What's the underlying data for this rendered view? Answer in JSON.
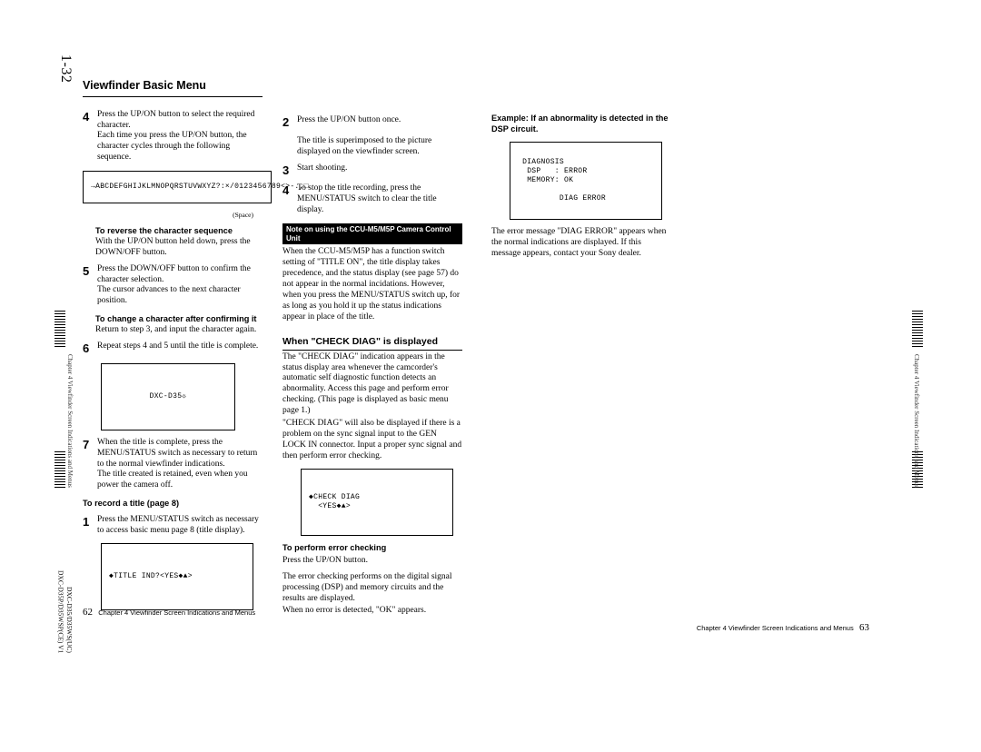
{
  "sheetNumber": "1-32",
  "sideCaption": "Chapter 4  Viewfinder Screen Indications and Menus",
  "modelLine1": "DXC-D35/D35WS(UC)",
  "modelLine2": "DXC-D35P/D35WSP(CE) V1",
  "p62": {
    "title": "Viewfinder Basic Menu",
    "col1": {
      "step4a": "Press the UP/ON button to select the required character.",
      "step4b": "Each time you press the UP/ON button, the character cycles through the following sequence.",
      "seqText": "→ABCDEFGHIJKLMNOPQRSTUVWXYZ?:×/0123456789<>-.,□",
      "seqCaption": "(Space)",
      "revHead": "To reverse the character sequence",
      "revBody": "With the UP/ON button held down, press the DOWN/OFF button.",
      "step5a": "Press the DOWN/OFF button to confirm the character selection.",
      "step5b": "The cursor advances to the next character position.",
      "chgHead": "To change a character after confirming it",
      "chgBody": "Return to step 3, and input the character again.",
      "step6": "Repeat steps 4 and 5 until the title is complete.",
      "dxcFig": "DXC-D35☼",
      "step7a": "When the title is complete, press the MENU/STATUS switch as necessary to return to the normal viewfinder indications.",
      "step7b": "The title created is retained, even when you power the camera off.",
      "recHead": "To record a title (page 8)",
      "step1": "Press the MENU/STATUS switch as necessary to access basic menu page 8 (title display).",
      "titleFig": "◆TITLE IND?<YES◆▲>"
    },
    "col2": {
      "step2a": "Press the UP/ON button once.",
      "step2b": "The title is superimposed to the picture displayed on the viewfinder screen.",
      "step3": "Start shooting.",
      "step4": "To stop the title recording, press the MENU/STATUS switch to clear the title display.",
      "noteBar": "Note on using the CCU-M5/M5P Camera Control Unit",
      "noteBody": "When the CCU-M5/M5P has a function switch setting of \"TITLE ON\", the title display takes precedence, and the status display (see page 57) do not appear in the normal incidations.  However, when you press the MENU/STATUS switch up, for as long as you hold it up the status indications appear in place of the title.",
      "h2": "When \"CHECK DIAG\" is displayed",
      "body1": "The \"CHECK DIAG\" indication appears in the status display area whenever the camcorder's automatic self diagnostic function detects an abnormality. Access this page and perform error checking. (This page is displayed as basic menu page 1.)",
      "body2": "\"CHECK DIAG\" will also be displayed if there is a problem on the sync signal input to the GEN LOCK IN connector.  Input a proper sync signal and then perform error checking.",
      "diagFig": "◆CHECK DIAG\n  <YES◆▲>",
      "perfHead": "To perform error checking",
      "perfBody1": "Press the UP/ON button.",
      "perfBody2": "The error checking performs on the digital signal processing (DSP) and memory circuits and the results are displayed.",
      "perfBody3": "When no error is detected, \"OK\" appears."
    },
    "footer": "Chapter 4   Viewfinder Screen Indications and Menus",
    "pageNum": "62"
  },
  "p63": {
    "exHead": "Example:  If an abnormality is detected in the DSP circuit.",
    "diagnFig": " DIAGNOSIS\n  DSP   : ERROR\n  MEMORY: OK\n\n         DIAG ERROR",
    "body": "The error message \"DIAG ERROR\" appears when the normal indications are displayed.  If this message appears, contact your Sony dealer.",
    "footer": "Chapter 4   Viewfinder Screen Indications and Menus",
    "pageNum": "63"
  }
}
